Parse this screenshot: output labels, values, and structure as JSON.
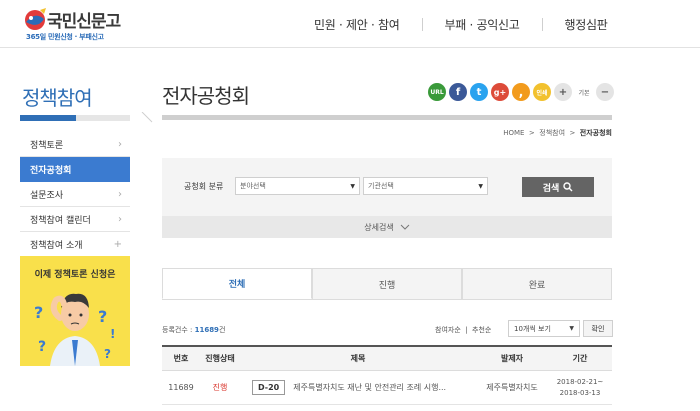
{
  "header": {
    "logo_main": "국민신문고",
    "logo_sub": "365일 민원신청 · 부패신고",
    "nav": [
      "민원 · 제안 · 참여",
      "부패 · 공익신고",
      "행정심판"
    ]
  },
  "sidebar": {
    "title": "정책참여",
    "items": [
      {
        "label": "정책토론",
        "arrow": "›"
      },
      {
        "label": "전자공청회",
        "arrow": ""
      },
      {
        "label": "설문조사",
        "arrow": "›"
      },
      {
        "label": "정책참여 캘린더",
        "arrow": "›"
      },
      {
        "label": "정책참여 소개",
        "arrow": "+"
      }
    ],
    "banner_text": "이제 정책토론 신청은"
  },
  "main": {
    "title": "전자공청회",
    "share": {
      "url": "URL",
      "facebook": "f",
      "twitter": "t",
      "google": "g+",
      "comma": ",",
      "print": "인쇄",
      "zoom_in": "+",
      "default": "기본",
      "zoom_out": "−"
    },
    "breadcrumb": {
      "home": "HOME",
      "sep": ">",
      "level1": "정책참여",
      "current": "전자공청회"
    },
    "search": {
      "label": "공청회 분류",
      "field_select": "분야선택",
      "org_select": "기관선택",
      "button": "검색"
    },
    "detail_search": "상세검색",
    "tabs": [
      "전체",
      "진행",
      "완료"
    ],
    "count_label": "등록건수 : ",
    "count_value": "11689",
    "count_unit": "건",
    "sort": {
      "participants": "참여자순",
      "sep": "|",
      "recommend": "추천순"
    },
    "page_size": "10개씩 보기",
    "confirm": "확인",
    "table": {
      "headers": [
        "번호",
        "진행상태",
        "제목",
        "발제자",
        "기간"
      ],
      "rows": [
        {
          "no": "11689",
          "status": "진행",
          "dday": "D-20",
          "title": "제주특별자치도 재난 및 안전관리 조례 시행...",
          "author": "제주특별자치도",
          "period_start": "2018-02-21~",
          "period_end": "2018-03-13"
        }
      ]
    }
  },
  "colors": {
    "accent": "#2f6fb6",
    "active_menu": "#3b7bd0",
    "status_red": "#d9342b",
    "banner": "#f9e04b"
  }
}
